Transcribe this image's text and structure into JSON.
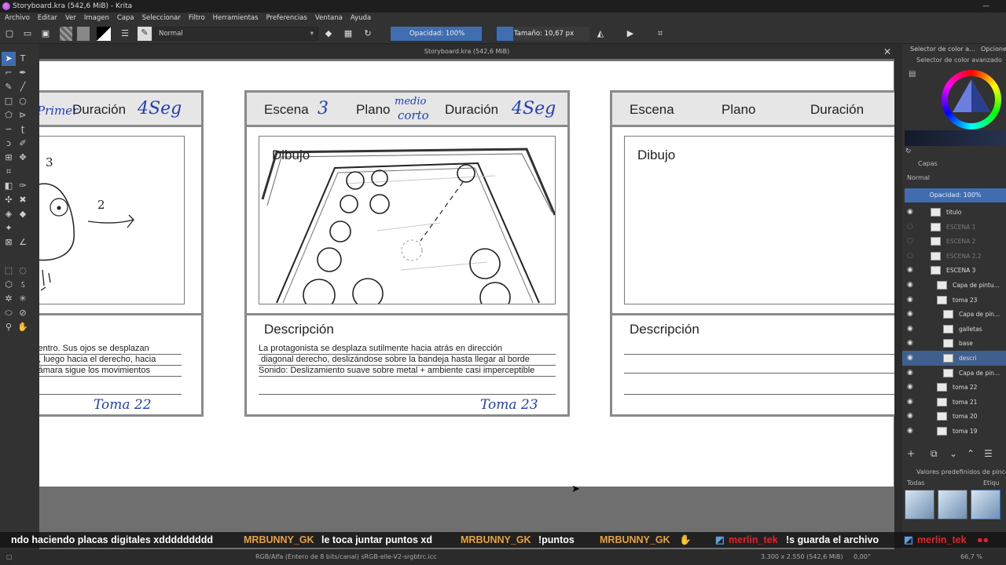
{
  "window": {
    "title": "Storyboard.kra (542,6 MiB) - Krita"
  },
  "menu": [
    "Archivo",
    "Editar",
    "Ver",
    "Imagen",
    "Capa",
    "Seleccionar",
    "Filtro",
    "Herramientas",
    "Preferencias",
    "Ventana",
    "Ayuda"
  ],
  "toolbar": {
    "blend_mode": "Normal",
    "opacity_label": "Opacidad: 100%",
    "opacity_value": 1.0,
    "size_label": "Tamaño: 10,67 px"
  },
  "document": {
    "tab_title": "Storyboard.kra (542,6 MiB)"
  },
  "storyboard": {
    "panel_left": {
      "header_handwritten_1": "Primer",
      "header_duration_label": "Duración",
      "header_duration_value": "4Seg",
      "sketch_notes": [
        "3",
        "2"
      ],
      "desc_lines": [
        "centro. Sus ojos se desplazan",
        "o, luego hacia el derecho, hacia",
        "cámara sigue los movimientos"
      ],
      "take": "Toma 22"
    },
    "panel_middle": {
      "scene_label": "Escena",
      "scene_value": "3",
      "plane_label": "Plano",
      "plane_value_1": "medio",
      "plane_value_2": "corto",
      "duration_label": "Duración",
      "duration_value": "4Seg",
      "drawing_label": "Dibujo",
      "description_label": "Descripción",
      "desc_lines": [
        "La protagonista se desplaza sutilmente hacia atrás en dirección",
        "diagonal derecho, deslizándose sobre la bandeja hasta llegar al borde",
        "Sonido: Deslizamiento suave sobre metal + ambiente casi imperceptible"
      ],
      "take": "Toma 23"
    },
    "panel_right": {
      "scene_label": "Escena",
      "plane_label": "Plano",
      "duration_label": "Duración",
      "drawing_label": "Dibujo",
      "description_label": "Descripción"
    }
  },
  "right_dock": {
    "color_tab": "Selector de color a...",
    "options_tab": "Opcione",
    "color_selector_title": "Selector de color avanzado",
    "layers_title": "Capas",
    "layers_blend": "Normal",
    "layers_opacity": "Opacidad:  100%",
    "layers": [
      {
        "name": "titulo",
        "visible": true
      },
      {
        "name": "ESCENA 1",
        "visible": false
      },
      {
        "name": "ESCENA 2",
        "visible": false
      },
      {
        "name": "ESCENA 2.2",
        "visible": false
      },
      {
        "name": "ESCENA 3",
        "visible": true
      },
      {
        "name": "Capa de pintu...",
        "visible": true
      },
      {
        "name": "toma 23",
        "visible": true
      },
      {
        "name": "Capa de pin...",
        "visible": true
      },
      {
        "name": "galletas",
        "visible": true
      },
      {
        "name": "base",
        "visible": true
      },
      {
        "name": "descri",
        "visible": true,
        "selected": true
      },
      {
        "name": "Capa de pin...",
        "visible": true
      },
      {
        "name": "toma 22",
        "visible": true
      },
      {
        "name": "toma 21",
        "visible": true
      },
      {
        "name": "toma 20",
        "visible": true
      },
      {
        "name": "toma 19",
        "visible": true
      }
    ],
    "brush_presets_title": "Valores predefinidos de pincel",
    "brush_filter": "Todas",
    "brush_tag": "Etiqu"
  },
  "chat": [
    {
      "user": "",
      "text": "ndo haciendo placas digitales xddddddddd"
    },
    {
      "user": "MRBUNNY_GK",
      "text": "le toca juntar puntos xd"
    },
    {
      "user": "MRBUNNY_GK",
      "text": "!puntos"
    },
    {
      "user": "MRBUNNY_GK",
      "text": ""
    },
    {
      "user": "merlin_tek",
      "text": "!s guarda el archivo"
    },
    {
      "user": "merlin_tek",
      "text": ""
    }
  ],
  "status": {
    "color_space": "RGB/Alfa (Entero de 8 bits/canal)  sRGB-elle-V2-srgbtrc.icc",
    "dimensions": "3.300 x 2.550 (542,6 MiB)",
    "rotation": "0,00°",
    "zoom": "66,7 %"
  },
  "colors": {
    "accent": "#3f6db0",
    "panel_border": "#8a8a8a",
    "header_fill": "#e6e6e6",
    "handwriting": "#2040b8",
    "chat_user_orange": "#e8a33a",
    "chat_user_red": "#e0242b"
  }
}
